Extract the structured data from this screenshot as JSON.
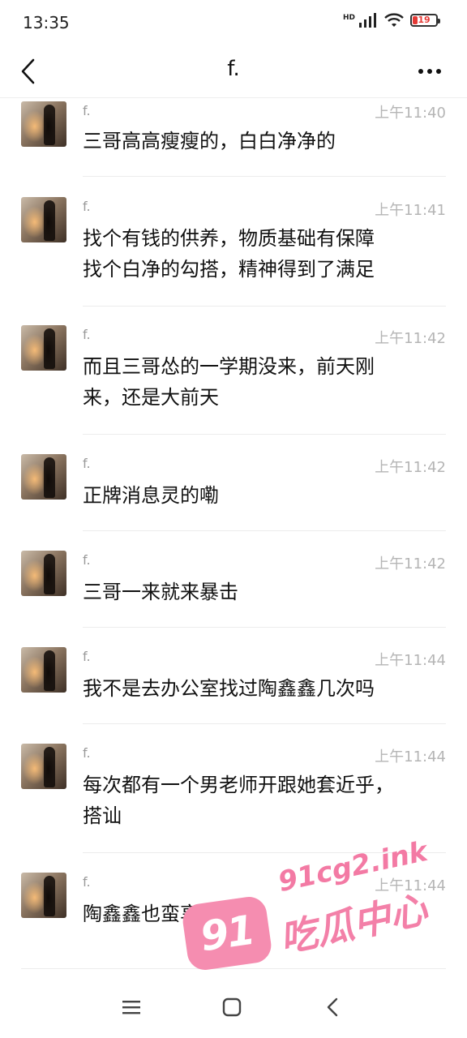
{
  "status_bar": {
    "time": "13:35",
    "network": "HD",
    "battery": "19",
    "battery_color": "#e53935",
    "icons": [
      "signal-icon",
      "wifi-icon",
      "battery-icon"
    ]
  },
  "header": {
    "title": "f.",
    "back_icon": "chevron-left-icon",
    "more_icon": "more-dots-icon"
  },
  "messages": [
    {
      "sender": "f.",
      "time": "上午11:40",
      "lines": [
        "三哥高高瘦瘦的，白白净净的"
      ]
    },
    {
      "sender": "f.",
      "time": "上午11:41",
      "lines": [
        "找个有钱的供养，物质基础有保障",
        "找个白净的勾搭，精神得到了满足"
      ]
    },
    {
      "sender": "f.",
      "time": "上午11:42",
      "lines": [
        "而且三哥怂的一学期没来，前天刚",
        "来，还是大前天"
      ]
    },
    {
      "sender": "f.",
      "time": "上午11:42",
      "lines": [
        "正牌消息灵的嘞"
      ]
    },
    {
      "sender": "f.",
      "time": "上午11:42",
      "lines": [
        "三哥一来就来暴击"
      ]
    },
    {
      "sender": "f.",
      "time": "上午11:44",
      "lines": [
        "我不是去办公室找过陶鑫鑫几次吗"
      ]
    },
    {
      "sender": "f.",
      "time": "上午11:44",
      "lines": [
        "每次都有一个男老师开跟她套近乎，",
        "搭讪"
      ]
    },
    {
      "sender": "f.",
      "time": "上午11:44",
      "lines": [
        "陶鑫鑫也蛮享受的"
      ]
    }
  ],
  "watermark": {
    "badge": "91",
    "domain": "91cg2.ink",
    "name": "吃瓜中心",
    "color": "#f37aa4"
  },
  "bottom_nav": {
    "icons": [
      "menu-icon",
      "home-square-icon",
      "back-chevron-icon"
    ]
  }
}
